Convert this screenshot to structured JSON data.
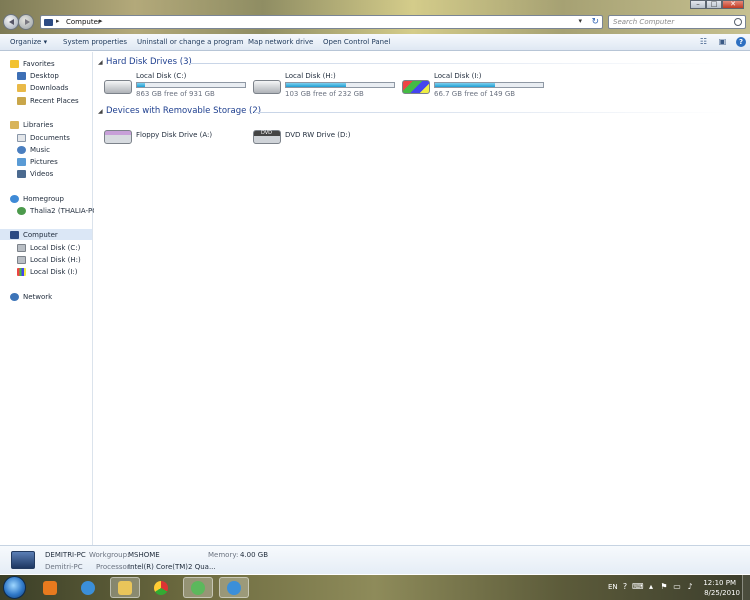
{
  "window": {
    "address_path": "Computer",
    "search_placeholder": "Search Computer",
    "controls": {
      "minimize": "–",
      "maximize": "□",
      "close": "✕"
    }
  },
  "toolbar": {
    "organize": "Organize ▾",
    "system_properties": "System properties",
    "uninstall": "Uninstall or change a program",
    "map_network_drive": "Map network drive",
    "open_control_panel": "Open Control Panel"
  },
  "nav": {
    "favorites": "Favorites",
    "desktop": "Desktop",
    "downloads": "Downloads",
    "recent_places": "Recent Places",
    "libraries": "Libraries",
    "documents": "Documents",
    "music": "Music",
    "pictures": "Pictures",
    "videos": "Videos",
    "homegroup": "Homegroup",
    "homegroup_user": "Thalia2 (THALIA-PC",
    "computer": "Computer",
    "disk_c": "Local Disk (C:)",
    "disk_h": "Local Disk (H:)",
    "disk_i": "Local Disk (I:)",
    "network": "Network"
  },
  "content": {
    "hard_disk_group": "Hard Disk Drives (3)",
    "removable_group": "Devices with Removable Storage (2)",
    "drives": [
      {
        "name": "Local Disk (C:)",
        "free": "863 GB free of 931 GB",
        "used_fraction": 0.073
      },
      {
        "name": "Local Disk (H:)",
        "free": "103 GB free of 232 GB",
        "used_fraction": 0.556
      },
      {
        "name": "Local Disk (I:)",
        "free": "66.7 GB free of 149 GB",
        "used_fraction": 0.552
      }
    ],
    "removable": [
      {
        "name": "Floppy Disk Drive (A:)"
      },
      {
        "name": "DVD RW Drive (D:)",
        "label": "DVD"
      }
    ]
  },
  "details": {
    "pc_name": "DEMITRI-PC",
    "pc_subname": "Demitri-PC",
    "workgroup_label": "Workgroup:",
    "workgroup": "MSHOME",
    "memory_label": "Memory:",
    "memory": "4.00 GB",
    "processor_label": "Processor:",
    "processor": "Intel(R) Core(TM)2 Qua..."
  },
  "taskbar": {
    "lang": "EN",
    "time": "12:10 PM",
    "date": "8/25/2010"
  },
  "colors": {
    "accent": "#1e3f8f",
    "bar_fill": "#1f9fd4"
  }
}
